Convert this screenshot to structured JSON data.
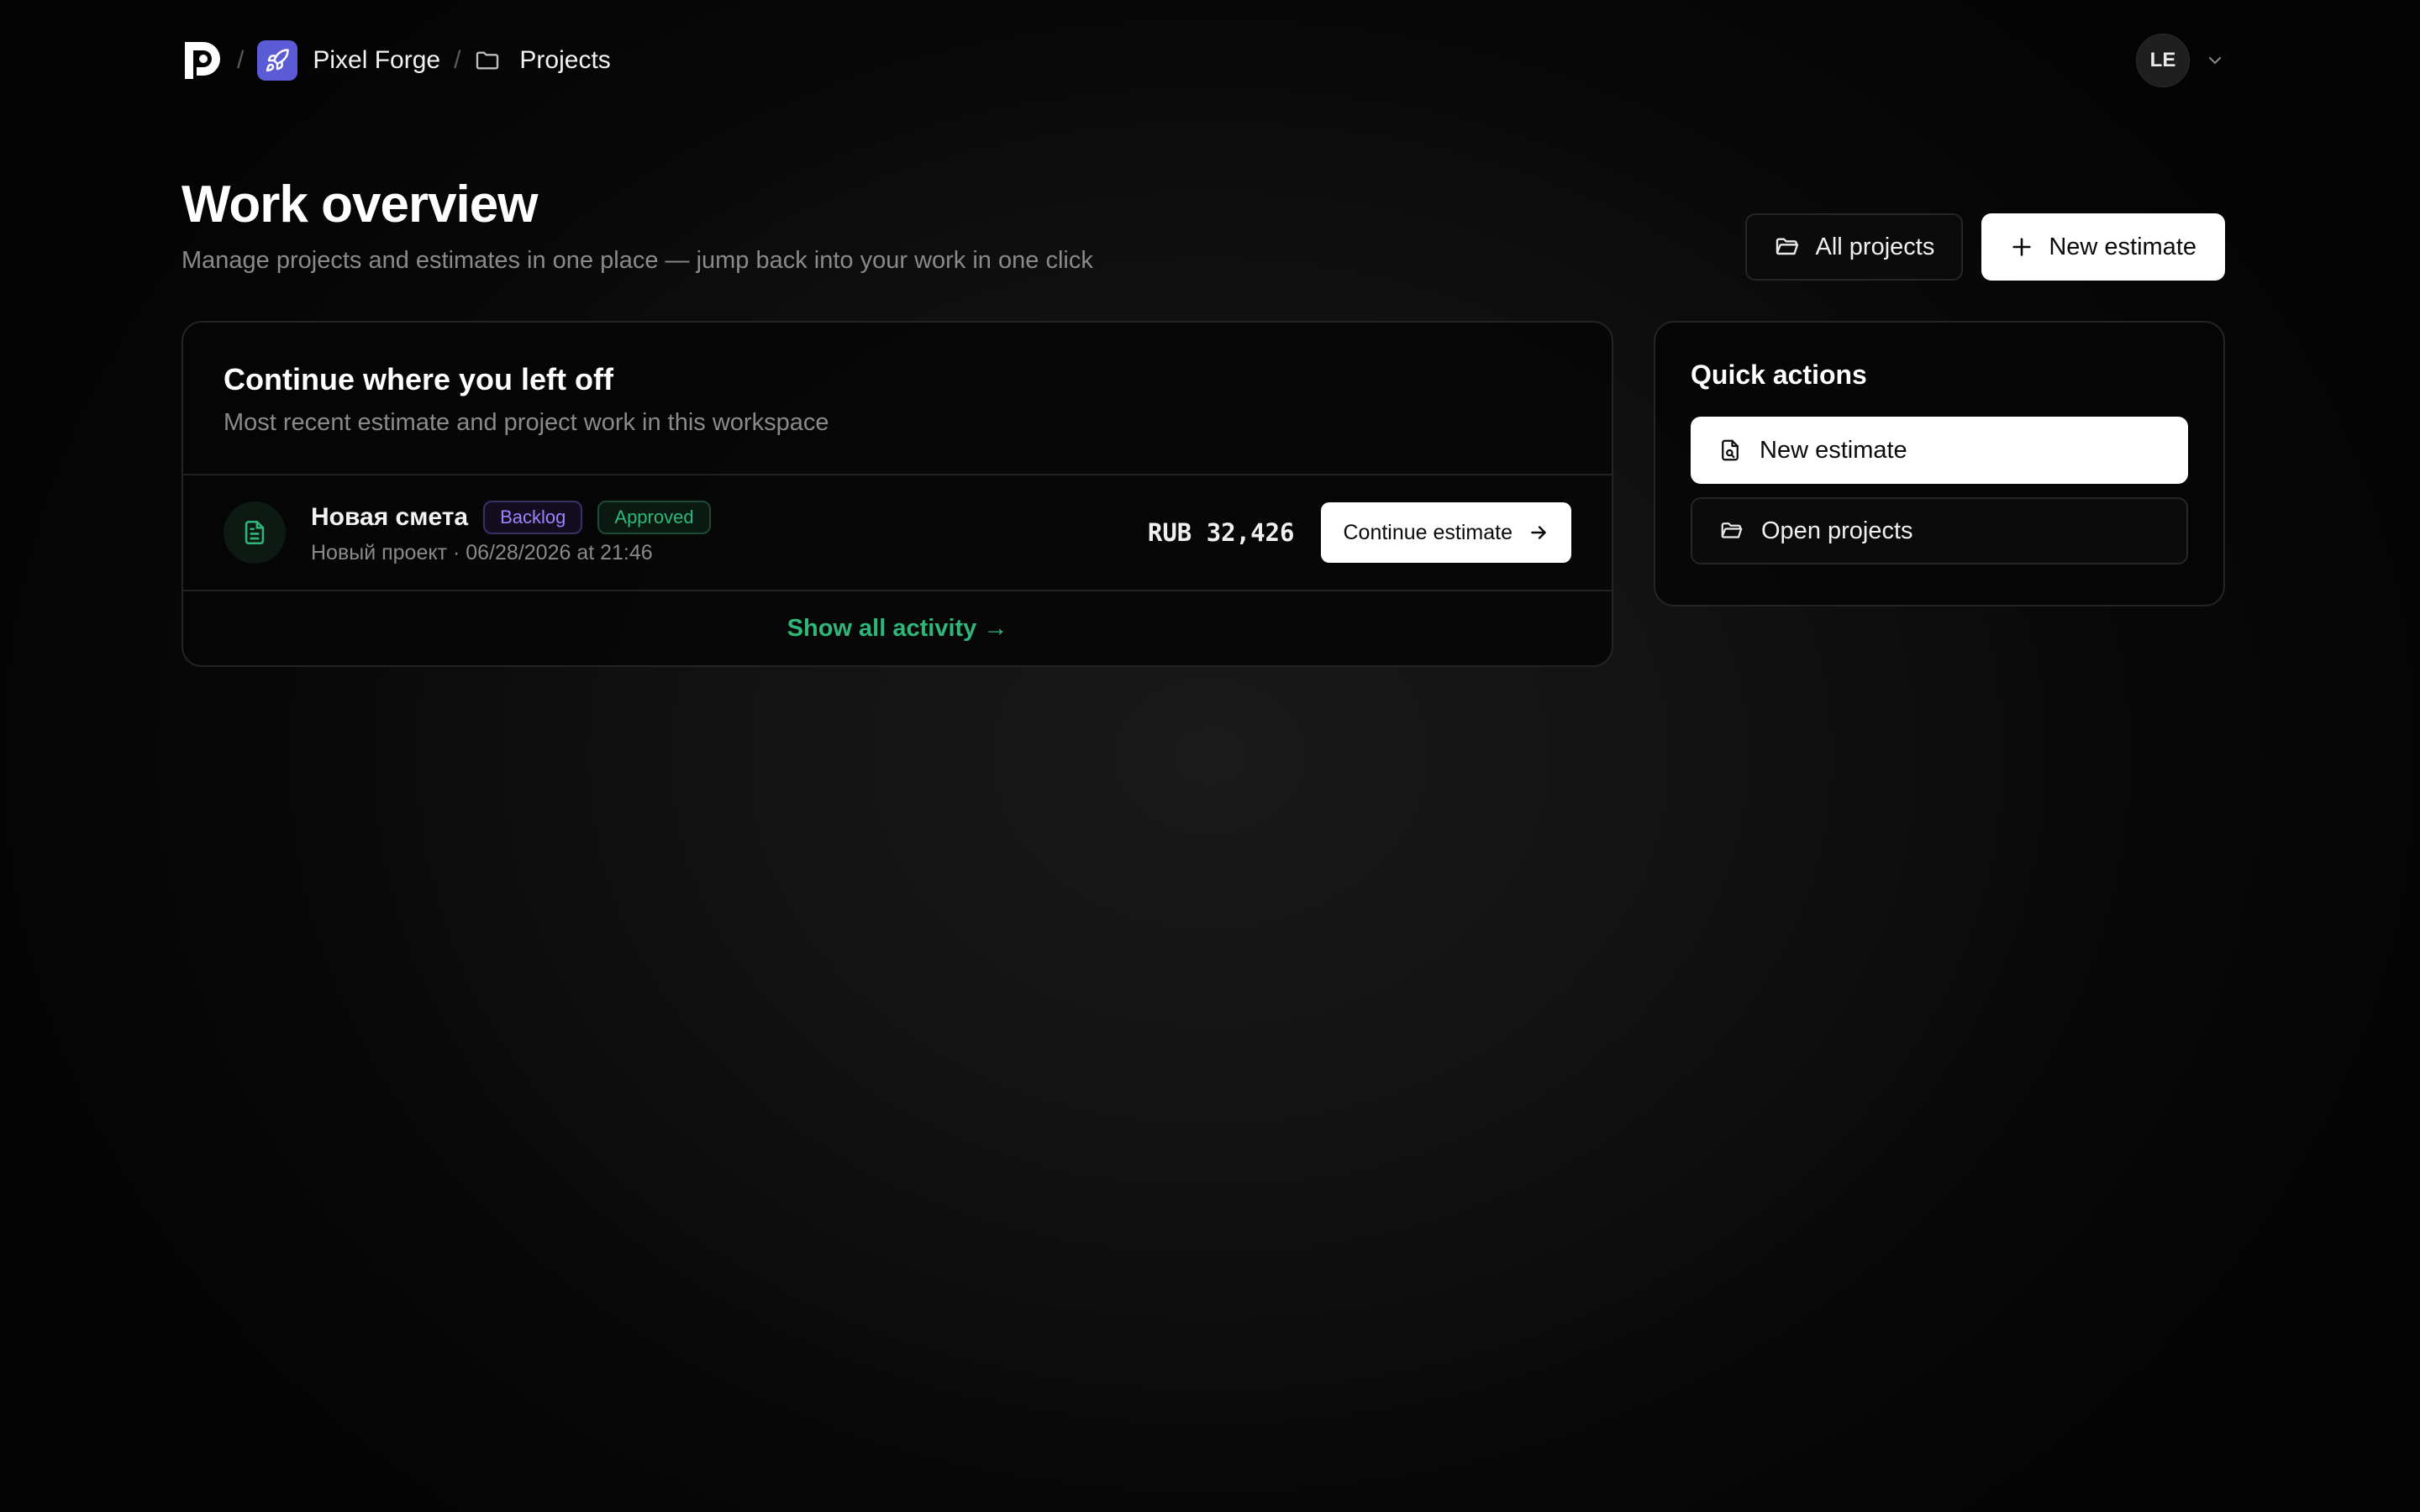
{
  "breadcrumb": {
    "separator": "/",
    "workspace": "Pixel Forge",
    "section": "Projects"
  },
  "user": {
    "initials": "LE"
  },
  "header": {
    "title": "Work overview",
    "subtitle": "Manage projects and estimates in one place — jump back into your work in one click",
    "all_projects_label": "All projects",
    "new_estimate_label": "New estimate"
  },
  "recent": {
    "title": "Continue where you left off",
    "subtitle": "Most recent estimate and project work in this workspace",
    "items": [
      {
        "name": "Новая смета",
        "tags": [
          "Backlog",
          "Approved"
        ],
        "meta": "Новый проект · 06/28/2026 at 21:46",
        "amount": "RUB 32,426",
        "action": "Continue estimate"
      }
    ],
    "show_all": "Show all activity →"
  },
  "quick_actions": {
    "title": "Quick actions",
    "new_estimate": "New estimate",
    "open_projects": "Open projects"
  },
  "colors": {
    "accent_green": "#2fb77a",
    "accent_purple": "#9b84ff",
    "workspace_avatar": "#5b5bd6"
  },
  "icons": [
    "app-logo-icon",
    "rocket-icon",
    "folder-icon",
    "chevron-down-icon",
    "folder-open-icon",
    "plus-icon",
    "document-icon",
    "arrow-right-icon",
    "file-search-icon"
  ]
}
